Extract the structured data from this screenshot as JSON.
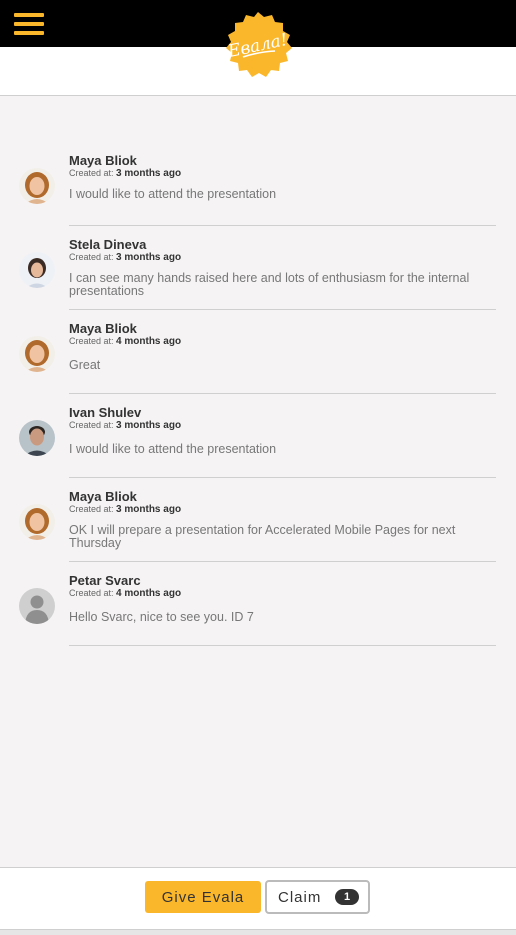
{
  "header": {
    "logo_text": "Евала!",
    "menu_icon": "hamburger-menu-icon"
  },
  "comments": [
    {
      "author": "Maya Bliok",
      "created_label": "Created at:",
      "created_value": "3 months ago",
      "text": "I would like to attend the presentation",
      "avatar": "maya"
    },
    {
      "author": "Stela Dineva",
      "created_label": "Created at:",
      "created_value": "3 months ago",
      "text": "I can see many hands raised here and lots of enthusiasm for the internal presentations",
      "avatar": "stela"
    },
    {
      "author": "Maya Bliok",
      "created_label": "Created at:",
      "created_value": "4 months ago",
      "text": "Great",
      "avatar": "maya"
    },
    {
      "author": "Ivan Shulev",
      "created_label": "Created at:",
      "created_value": "3 months ago",
      "text": "I would like to attend the presentation",
      "avatar": "ivan"
    },
    {
      "author": "Maya Bliok",
      "created_label": "Created at:",
      "created_value": "3 months ago",
      "text": "OK I will prepare a presentation for Accelerated Mobile Pages for next Thursday",
      "avatar": "maya"
    },
    {
      "author": "Petar Svarc",
      "created_label": "Created at:",
      "created_value": "4 months ago",
      "text": "Hello Svarc, nice to see you. ID 7",
      "avatar": "default"
    }
  ],
  "footer": {
    "give_label": "Give Evala",
    "claim_label": "Claim",
    "claim_count": "1"
  },
  "colors": {
    "accent": "#fbb72b",
    "topbar": "#000000",
    "background": "#f5f3f4"
  }
}
